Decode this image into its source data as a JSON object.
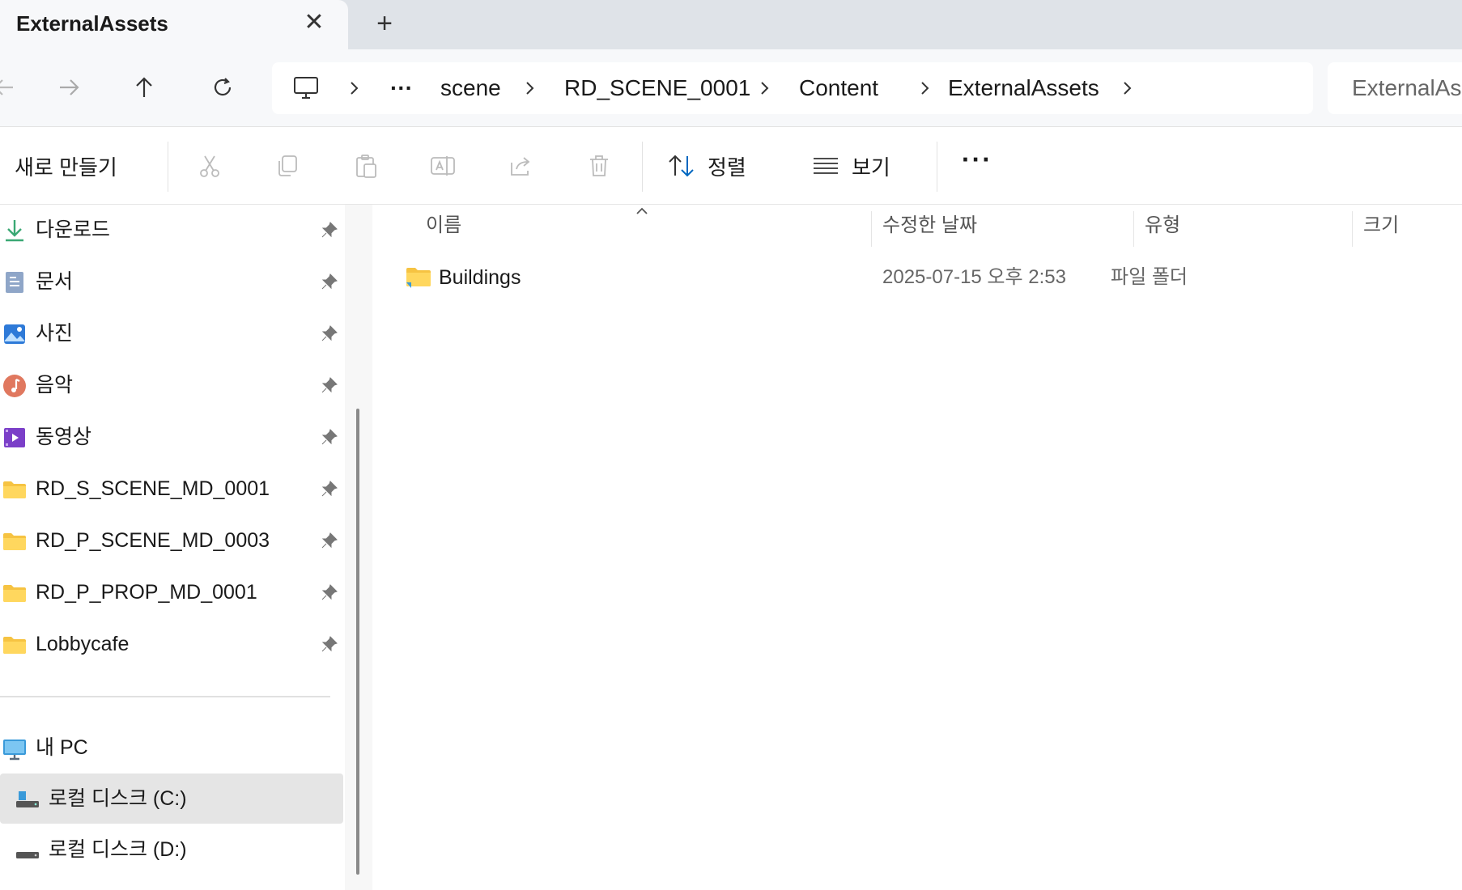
{
  "tab": {
    "title": "ExternalAssets",
    "close_symbol": "✕",
    "new_tab_symbol": "+"
  },
  "nav": {
    "back_icon": "arrow-left-icon",
    "forward_icon": "arrow-right-icon",
    "up_icon": "arrow-up-icon",
    "refresh_icon": "refresh-icon"
  },
  "address": {
    "overflow_label": "···",
    "crumbs": [
      "scene",
      "RD_SCENE_0001",
      "Content",
      "ExternalAssets"
    ]
  },
  "search": {
    "text": "ExternalAssets"
  },
  "commandbar": {
    "new_label": "새로 만들기",
    "sort_label": "정렬",
    "view_label": "보기",
    "more_label": "···"
  },
  "sidebar": {
    "items": [
      {
        "label": "다운로드",
        "icon": "download-icon",
        "pinned": true
      },
      {
        "label": "문서",
        "icon": "document-icon",
        "pinned": true
      },
      {
        "label": "사진",
        "icon": "pictures-icon",
        "pinned": true
      },
      {
        "label": "음악",
        "icon": "music-icon",
        "pinned": true
      },
      {
        "label": "동영상",
        "icon": "video-icon",
        "pinned": true
      },
      {
        "label": "RD_S_SCENE_MD_0001",
        "icon": "folder-icon",
        "pinned": true
      },
      {
        "label": "RD_P_SCENE_MD_0003",
        "icon": "folder-icon",
        "pinned": true
      },
      {
        "label": "RD_P_PROP_MD_0001",
        "icon": "folder-icon",
        "pinned": true
      },
      {
        "label": "Lobbycafe",
        "icon": "folder-icon",
        "pinned": true
      }
    ],
    "this_pc": "내 PC",
    "drives": [
      {
        "label": "로컬 디스크 (C:)",
        "selected": true
      },
      {
        "label": "로컬 디스크 (D:)",
        "selected": false
      }
    ]
  },
  "columns": {
    "name": "이름",
    "date": "수정한 날짜",
    "type": "유형",
    "size": "크기"
  },
  "files": [
    {
      "name": "Buildings",
      "date": "2025-07-15 오후 2:53",
      "type": "파일 폴더",
      "size": ""
    }
  ],
  "colors": {
    "folder": "#f6c342",
    "accent": "#0067c0",
    "selected_bg": "#e5e5e5"
  }
}
